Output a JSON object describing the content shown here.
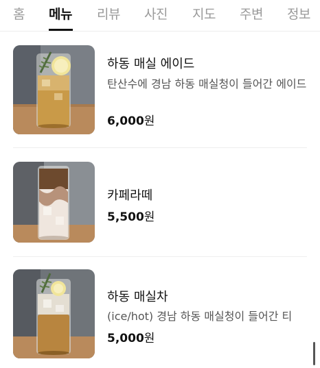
{
  "tabs": [
    {
      "label": "홈",
      "active": false
    },
    {
      "label": "메뉴",
      "active": true
    },
    {
      "label": "리뷰",
      "active": false
    },
    {
      "label": "사진",
      "active": false
    },
    {
      "label": "지도",
      "active": false
    },
    {
      "label": "주변",
      "active": false
    },
    {
      "label": "정보",
      "active": false
    }
  ],
  "menu": {
    "items": [
      {
        "name": "하동 매실 에이드",
        "description": "탄산수에 경남 하동 매실청이 들어간 에이드",
        "price": "6,000",
        "currency": "원",
        "photo_icon": "iced-plum-ade-photo"
      },
      {
        "name": "카페라떼",
        "description": "",
        "price": "5,500",
        "currency": "원",
        "photo_icon": "iced-cafe-latte-photo"
      },
      {
        "name": "하동 매실차",
        "description": "(ice/hot) 경남 하동 매실청이 들어간 티",
        "price": "5,000",
        "currency": "원",
        "photo_icon": "iced-plum-tea-photo"
      }
    ]
  },
  "colors": {
    "active_tab": "#111111",
    "inactive_tab": "#9a9a9a",
    "description": "#555555"
  }
}
